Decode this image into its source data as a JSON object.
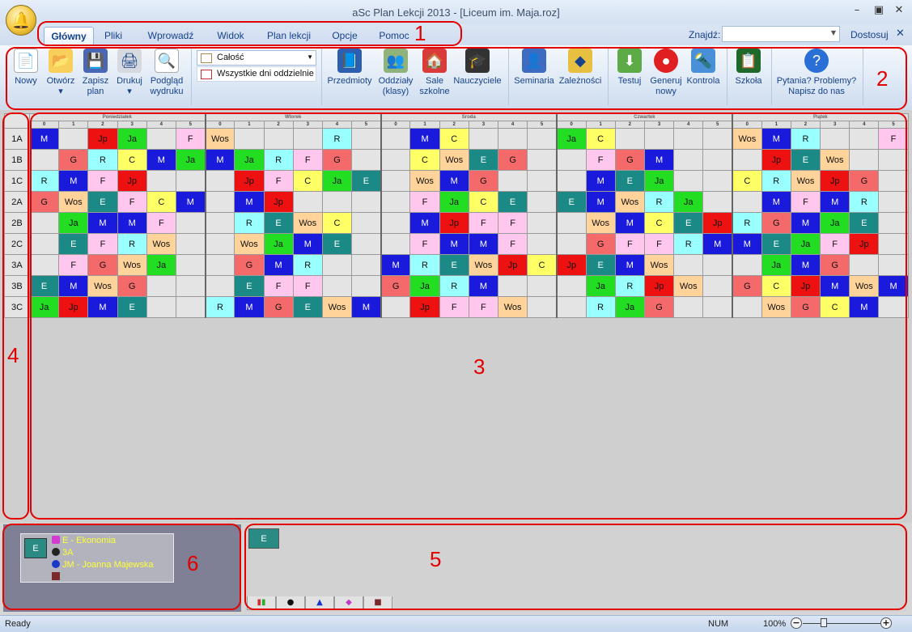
{
  "window": {
    "title": "aSc Plan Lekcji 2013  - [Liceum im. Maja.roz]",
    "min_icon": "minimize-icon",
    "max_icon": "maximize-icon",
    "close_icon": "close-icon"
  },
  "tabs": [
    "Główny",
    "Pliki",
    "Wprowadź",
    "Widok",
    "Plan lekcji",
    "Opcje",
    "Pomoc"
  ],
  "find": {
    "label": "Znajdź:",
    "value": ""
  },
  "customize_label": "Dostosuj",
  "ribbon": {
    "buttons": [
      {
        "label": "Nowy",
        "icon": "new-document-icon"
      },
      {
        "label": "Otwórz",
        "icon": "open-folder-icon"
      },
      {
        "label": "Zapisz plan",
        "icon": "save-disk-icon"
      },
      {
        "label": "Drukuj",
        "icon": "printer-icon"
      },
      {
        "label": "Podgląd wydruku",
        "icon": "print-preview-icon"
      },
      {
        "label": "Przedmioty",
        "icon": "book-icon"
      },
      {
        "label": "Oddziały (klasy)",
        "icon": "class-group-icon"
      },
      {
        "label": "Sale szkolne",
        "icon": "house-icon"
      },
      {
        "label": "Nauczyciele",
        "icon": "teacher-icon"
      },
      {
        "label": "Seminaria",
        "icon": "seminar-icon"
      },
      {
        "label": "Zależności",
        "icon": "relations-icon"
      },
      {
        "label": "Testuj",
        "icon": "test-icon"
      },
      {
        "label": "Generuj nowy",
        "icon": "generate-icon"
      },
      {
        "label": "Kontrola",
        "icon": "control-icon"
      },
      {
        "label": "Szkoła",
        "icon": "school-board-icon"
      },
      {
        "label": "Pytania? Problemy? Napisz do nas",
        "icon": "help-icon"
      }
    ],
    "combo_view": "Całość",
    "combo_days": "Wszystkie dni oddzielnie"
  },
  "timetable": {
    "days": [
      "Poniedziałek",
      "Wtorek",
      "Środa",
      "Czwartek",
      "Piątek"
    ],
    "periods": [
      "0",
      "1",
      "2",
      "3",
      "4",
      "5"
    ],
    "colors": {
      "M": "#1a1adc",
      "Jp": "#ee1111",
      "Ja": "#22dd22",
      "F": "#ffc6ee",
      "Wos": "#ffd39a",
      "R": "#99ffff",
      "G": "#f46a6a",
      "C": "#ffff66",
      "E": "#1b8a86"
    },
    "rows": [
      {
        "cls": "1A",
        "cells": [
          "M",
          "",
          "Jp",
          "Ja",
          "",
          "F",
          "Wos",
          "",
          "",
          "",
          "R",
          "",
          "",
          "M",
          "C",
          "",
          "",
          "",
          "Ja",
          "C",
          "",
          "",
          "",
          "",
          "Wos",
          "M",
          "R",
          "",
          "",
          "F"
        ]
      },
      {
        "cls": "1B",
        "cells": [
          "",
          "G",
          "R",
          "C",
          "M",
          "Ja",
          "M",
          "Ja",
          "R",
          "F",
          "G",
          "",
          "",
          "C",
          "Wos",
          "E",
          "G",
          "",
          "",
          "F",
          "G",
          "M",
          "",
          "",
          "",
          "Jp",
          "E",
          "Wos",
          "",
          ""
        ]
      },
      {
        "cls": "1C",
        "cells": [
          "R",
          "M",
          "F",
          "Jp",
          "",
          "",
          "",
          "Jp",
          "F",
          "C",
          "Ja",
          "E",
          "",
          "Wos",
          "M",
          "G",
          "",
          "",
          "",
          "M",
          "E",
          "Ja",
          "",
          "",
          "C",
          "R",
          "Wos",
          "Jp",
          "G",
          ""
        ]
      },
      {
        "cls": "2A",
        "cells": [
          "G",
          "Wos",
          "E",
          "F",
          "C",
          "M",
          "",
          "M",
          "Jp",
          "",
          "",
          "",
          "",
          "F",
          "Ja",
          "C",
          "E",
          "",
          "E",
          "M",
          "Wos",
          "R",
          "Ja",
          "",
          "",
          "M",
          "F",
          "M",
          "R",
          ""
        ]
      },
      {
        "cls": "2B",
        "cells": [
          "",
          "Ja",
          "M",
          "M",
          "F",
          "",
          "",
          "R",
          "E",
          "Wos",
          "C",
          "",
          "",
          "M",
          "Jp",
          "F",
          "F",
          "",
          "",
          "Wos",
          "M",
          "C",
          "E",
          "Jp",
          "R",
          "G",
          "M",
          "Ja",
          "E",
          ""
        ]
      },
      {
        "cls": "2C",
        "cells": [
          "",
          "E",
          "F",
          "R",
          "Wos",
          "",
          "",
          "Wos",
          "Ja",
          "M",
          "E",
          "",
          "",
          "F",
          "M",
          "M",
          "F",
          "",
          "",
          "G",
          "F",
          "F",
          "R",
          "M",
          "M",
          "E",
          "Ja",
          "F",
          "Jp",
          ""
        ]
      },
      {
        "cls": "3A",
        "cells": [
          "",
          "F",
          "G",
          "Wos",
          "Ja",
          "",
          "",
          "G",
          "M",
          "R",
          "",
          "",
          "M",
          "R",
          "E",
          "Wos",
          "Jp",
          "C",
          "Jp",
          "E",
          "M",
          "Wos",
          "",
          "",
          "",
          "Ja",
          "M",
          "G",
          "",
          ""
        ]
      },
      {
        "cls": "3B",
        "cells": [
          "E",
          "M",
          "Wos",
          "G",
          "",
          "",
          "",
          "E",
          "F",
          "F",
          "",
          "",
          "G",
          "Ja",
          "R",
          "M",
          "",
          "",
          "",
          "Ja",
          "R",
          "Jp",
          "Wos",
          "",
          "G",
          "C",
          "Jp",
          "M",
          "Wos",
          "M"
        ]
      },
      {
        "cls": "3C",
        "cells": [
          "Ja",
          "Jp",
          "M",
          "E",
          "",
          "",
          "R",
          "M",
          "G",
          "E",
          "Wos",
          "M",
          "",
          "Jp",
          "F",
          "F",
          "Wos",
          "",
          "",
          "R",
          "Ja",
          "G",
          "",
          "",
          "",
          "Wos",
          "G",
          "C",
          "M",
          ""
        ]
      }
    ]
  },
  "info": {
    "card": "E",
    "subject": "E - Ekonomia",
    "class": "3A",
    "teacher": "JM - Joanna Majewska",
    "room": ""
  },
  "cards_panel": {
    "card": "E",
    "tab_icons": [
      "chart-icon",
      "person-icon",
      "graduation-cap-icon",
      "book-stack-icon",
      "desk-icon"
    ]
  },
  "status": {
    "text": "Ready",
    "num": "NUM",
    "zoom": "100%"
  },
  "annotations": [
    "1",
    "2",
    "3",
    "4",
    "5",
    "6"
  ]
}
